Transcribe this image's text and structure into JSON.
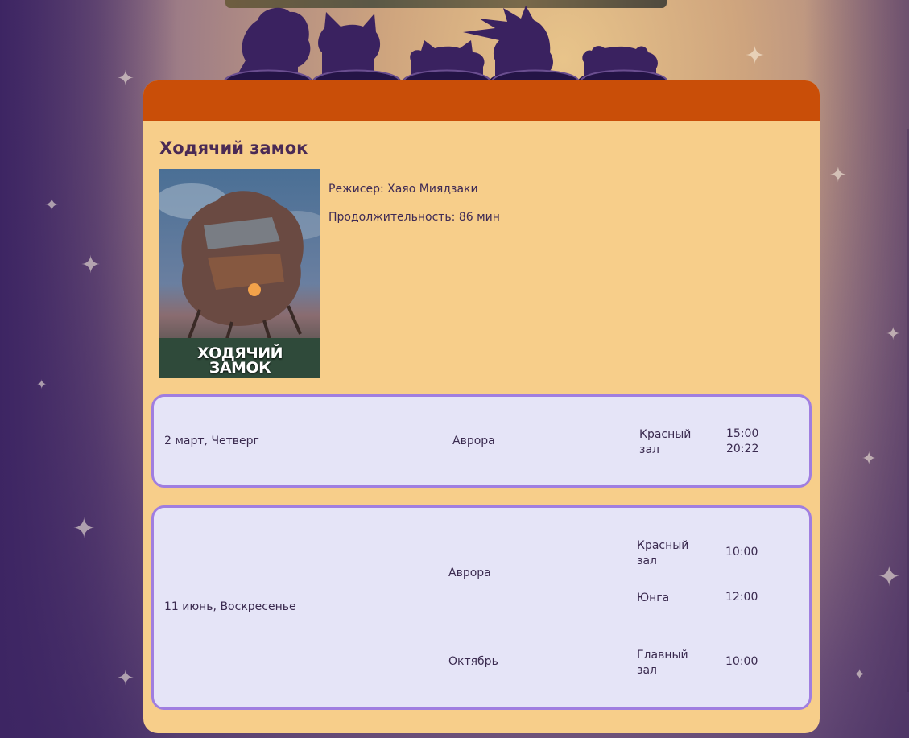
{
  "film": {
    "title": "Ходячий замок",
    "poster_text_line1": "ХОДЯЧИЙ",
    "poster_text_line2": "ЗАМОК",
    "director": "Режисер: Хаяо Миядзаки",
    "duration": "Продолжительность: 86 мин"
  },
  "sessions": [
    {
      "date": "2 март, Четверг",
      "cinema": "Аврора",
      "hall": "Красный зал",
      "times": [
        "15:00",
        "20:22"
      ]
    },
    {
      "date": "11 июнь, Воскресенье",
      "cinemas": [
        {
          "name": "Аврора",
          "halls": [
            {
              "hall": "Красный зал",
              "time": "10:00"
            },
            {
              "hall": "Юнга",
              "time": "12:00"
            }
          ]
        },
        {
          "name": "Октябрь",
          "halls": [
            {
              "hall": "Главный зал",
              "time": "10:00"
            }
          ]
        }
      ]
    }
  ],
  "colors": {
    "header_accent": "#c94e08",
    "card_bg": "#f7ce8a",
    "session_bg": "#e5e4f7",
    "session_border": "#a07ee0",
    "title_text": "#4a2a55"
  }
}
